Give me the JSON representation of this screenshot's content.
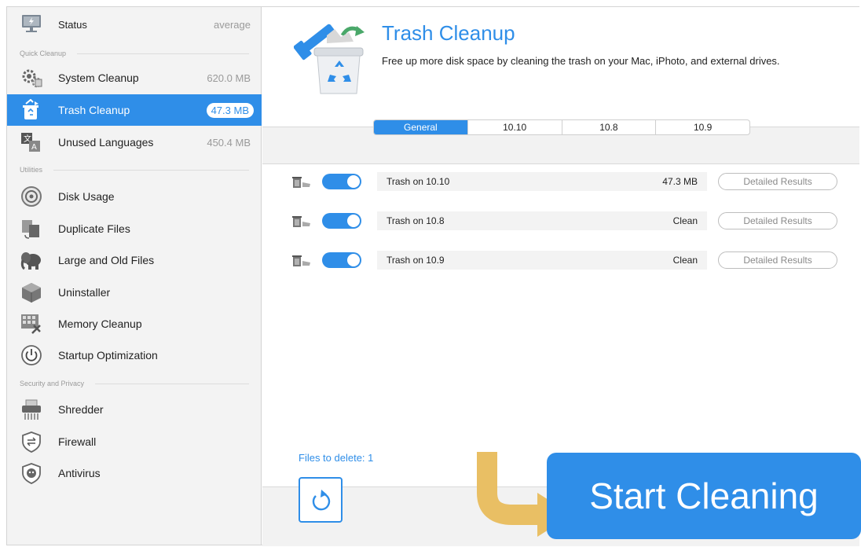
{
  "colors": {
    "accent": "#2f8ee8",
    "arrow": "#e9bf64",
    "sidebar_bg": "#f3f3f3",
    "muted": "#9a9a9a"
  },
  "sidebar": {
    "status": {
      "label": "Status",
      "value": "average",
      "icon": "monitor-icon"
    },
    "sections": {
      "quick": "Quick Cleanup",
      "utilities": "Utilities",
      "security": "Security and Privacy"
    },
    "items": [
      {
        "label": "System Cleanup",
        "value": "620.0 MB",
        "icon": "gears-icon"
      },
      {
        "label": "Trash Cleanup",
        "value": "47.3 MB",
        "icon": "trash-icon",
        "active": true
      },
      {
        "label": "Unused Languages",
        "value": "450.4 MB",
        "icon": "language-icon"
      },
      {
        "label": "Disk Usage",
        "icon": "disk-icon"
      },
      {
        "label": "Duplicate Files",
        "icon": "duplicate-icon"
      },
      {
        "label": "Large and Old Files",
        "icon": "elephant-icon"
      },
      {
        "label": "Uninstaller",
        "icon": "box-icon"
      },
      {
        "label": "Memory Cleanup",
        "icon": "memory-icon"
      },
      {
        "label": "Startup Optimization",
        "icon": "power-icon"
      },
      {
        "label": "Shredder",
        "icon": "shredder-icon"
      },
      {
        "label": "Firewall",
        "icon": "firewall-icon"
      },
      {
        "label": "Antivirus",
        "icon": "antivirus-icon"
      }
    ]
  },
  "main": {
    "title": "Trash Cleanup",
    "description": "Free up more disk space by cleaning the trash on your Mac, iPhoto, and external drives.",
    "tabs": [
      "General",
      "10.10",
      "10.8",
      "10.9"
    ],
    "active_tab": "General",
    "rows": [
      {
        "name": "Trash on 10.10",
        "size": "47.3 MB",
        "button": "Detailed Results",
        "enabled": true
      },
      {
        "name": "Trash on 10.8",
        "size": "Clean",
        "button": "Detailed Results",
        "enabled": true
      },
      {
        "name": "Trash on 10.9",
        "size": "Clean",
        "button": "Detailed Results",
        "enabled": true
      }
    ],
    "files_to_delete": "Files to delete: 1",
    "start_button": "Start Cleaning"
  }
}
